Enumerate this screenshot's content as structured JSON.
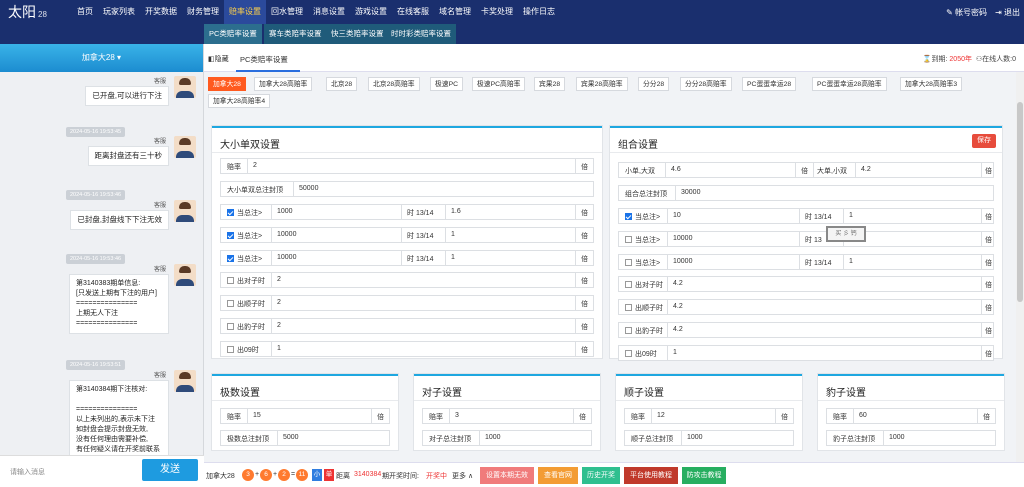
{
  "app": {
    "logo": "太阳",
    "logo_sub": "28"
  },
  "topnav": {
    "items": [
      "首页",
      "玩家列表",
      "开奖数据",
      "财务管理",
      "赔率设置",
      "回水管理",
      "消息设置",
      "游戏设置",
      "在线客服",
      "域名管理",
      "卡奖处理",
      "操作日志"
    ],
    "active_index": 4,
    "right": {
      "account": "帐号密码",
      "logout": "退出"
    }
  },
  "subnav": {
    "items": [
      "PC类赔率设置",
      "赛车类赔率设置",
      "快三类赔率设置",
      "时时彩类赔率设置"
    ],
    "active_index": 0
  },
  "sidebar": {
    "header": "加拿大28 ▾",
    "messages": [
      {
        "who": "客服",
        "text": "已开盘,可以进行下注"
      },
      {
        "time": "2024-05-16 19:53:45"
      },
      {
        "who": "客服",
        "text": "距离封盘还有三十秒"
      },
      {
        "time": "2024-05-16 19:53:46"
      },
      {
        "who": "客服",
        "text": "已封盘,封盘线下下注无效"
      },
      {
        "time": "2024-05-16 19:53:46"
      },
      {
        "who": "客服",
        "text": "第3140383期单信息:\n[只发送上期有下注的用户]\n===============\n上期无人下注\n==============="
      },
      {
        "time": "2024-05-16 19:53:51"
      },
      {
        "who": "客服",
        "text": "第3140384期下注核对:\n\n===============\n以上未列出的,表示未下注\n如封盘会提示封盘无效,\n没有任何理由需要补偿,\n有任何疑义请在开奖前联系"
      }
    ],
    "input_placeholder": "请输入消息",
    "send": "发送"
  },
  "tabbar": {
    "hide": "隐藏",
    "tab": "PC类赔率设置",
    "expire_label": "到期:",
    "expire_year": "2050年",
    "online": "在线人数:0"
  },
  "types": [
    "加拿大28",
    "加拿大28高赔率",
    "北京28",
    "北京28高赔率",
    "极速PC",
    "极速PC高赔率",
    "宾果28",
    "宾果28高赔率",
    "分分28",
    "分分28高赔率",
    "PC蛋蛋幸运28",
    "PC蛋蛋幸运28高赔率",
    "加拿大28高赔率3",
    "加拿大28高赔率4"
  ],
  "big_small": {
    "title": "大小单双设置",
    "odds_label": "赔率",
    "odds": "2",
    "unit": "倍",
    "cap_label": "大小单双总注封顶",
    "cap": "50000",
    "rules": [
      {
        "label": "当总注>",
        "value": "1000",
        "time": "时 13/14",
        "odds": "1.6"
      },
      {
        "label": "当总注>",
        "value": "10000",
        "time": "时 13/14",
        "odds": "1"
      },
      {
        "label": "当总注>",
        "value": "10000",
        "time": "时 13/14",
        "odds": "1"
      }
    ],
    "extras": [
      {
        "label": "出对子时",
        "value": "2"
      },
      {
        "label": "出顺子时",
        "value": "2"
      },
      {
        "label": "出豹子时",
        "value": "2"
      },
      {
        "label": "出09时",
        "value": "1"
      }
    ]
  },
  "combo": {
    "title": "组合设置",
    "save": "保存",
    "left_label": "小单,大双",
    "left_val": "4.6",
    "right_label": "大单,小双",
    "right_val": "4.2",
    "unit": "倍",
    "cap_label": "组合总注封顶",
    "cap": "30000",
    "rules": [
      {
        "label": "当总注>",
        "value": "10",
        "time": "时 13/14",
        "odds": "1"
      },
      {
        "label": "当总注>",
        "value": "10000",
        "time": "时 13",
        "odds": ""
      },
      {
        "label": "当总注>",
        "value": "10000",
        "time": "时 13/14",
        "odds": "1"
      }
    ],
    "stamp": "买 彡 钙",
    "extras": [
      {
        "label": "出对子时",
        "value": "4.2"
      },
      {
        "label": "出顺子时",
        "value": "4.2"
      },
      {
        "label": "出豹子时",
        "value": "4.2"
      },
      {
        "label": "出09时",
        "value": "1"
      }
    ]
  },
  "small_panels": [
    {
      "title": "极数设置",
      "odds_label": "赔率",
      "odds": "15",
      "unit": "倍",
      "cap_label": "极数总注封顶",
      "cap": "5000"
    },
    {
      "title": "对子设置",
      "odds_label": "赔率",
      "odds": "3",
      "unit": "倍",
      "cap_label": "对子总注封顶",
      "cap": "1000"
    },
    {
      "title": "顺子设置",
      "odds_label": "赔率",
      "odds": "12",
      "unit": "倍",
      "cap_label": "顺子总注封顶",
      "cap": "1000"
    },
    {
      "title": "豹子设置",
      "odds_label": "赔率",
      "odds": "60",
      "unit": "倍",
      "cap_label": "豹子总注封顶",
      "cap": "1000"
    }
  ],
  "bottom": {
    "game": "加拿大28",
    "balls": [
      "3",
      "6",
      "2",
      "11"
    ],
    "plus": "+",
    "eq": "=",
    "size": "小",
    "parity": "单",
    "distance": "距离",
    "period": "3140384",
    "period_suffix": "期开奖时间:",
    "status": "开奖中",
    "more": "更多 ∧",
    "buttons": [
      "设置本期无效",
      "查看官网",
      "历史开奖",
      "平台使用教程",
      "防攻击教程"
    ],
    "button_colors": [
      "#f07b7b",
      "#f39c34",
      "#2fbf8f",
      "#c0392b",
      "#27ae60"
    ]
  }
}
